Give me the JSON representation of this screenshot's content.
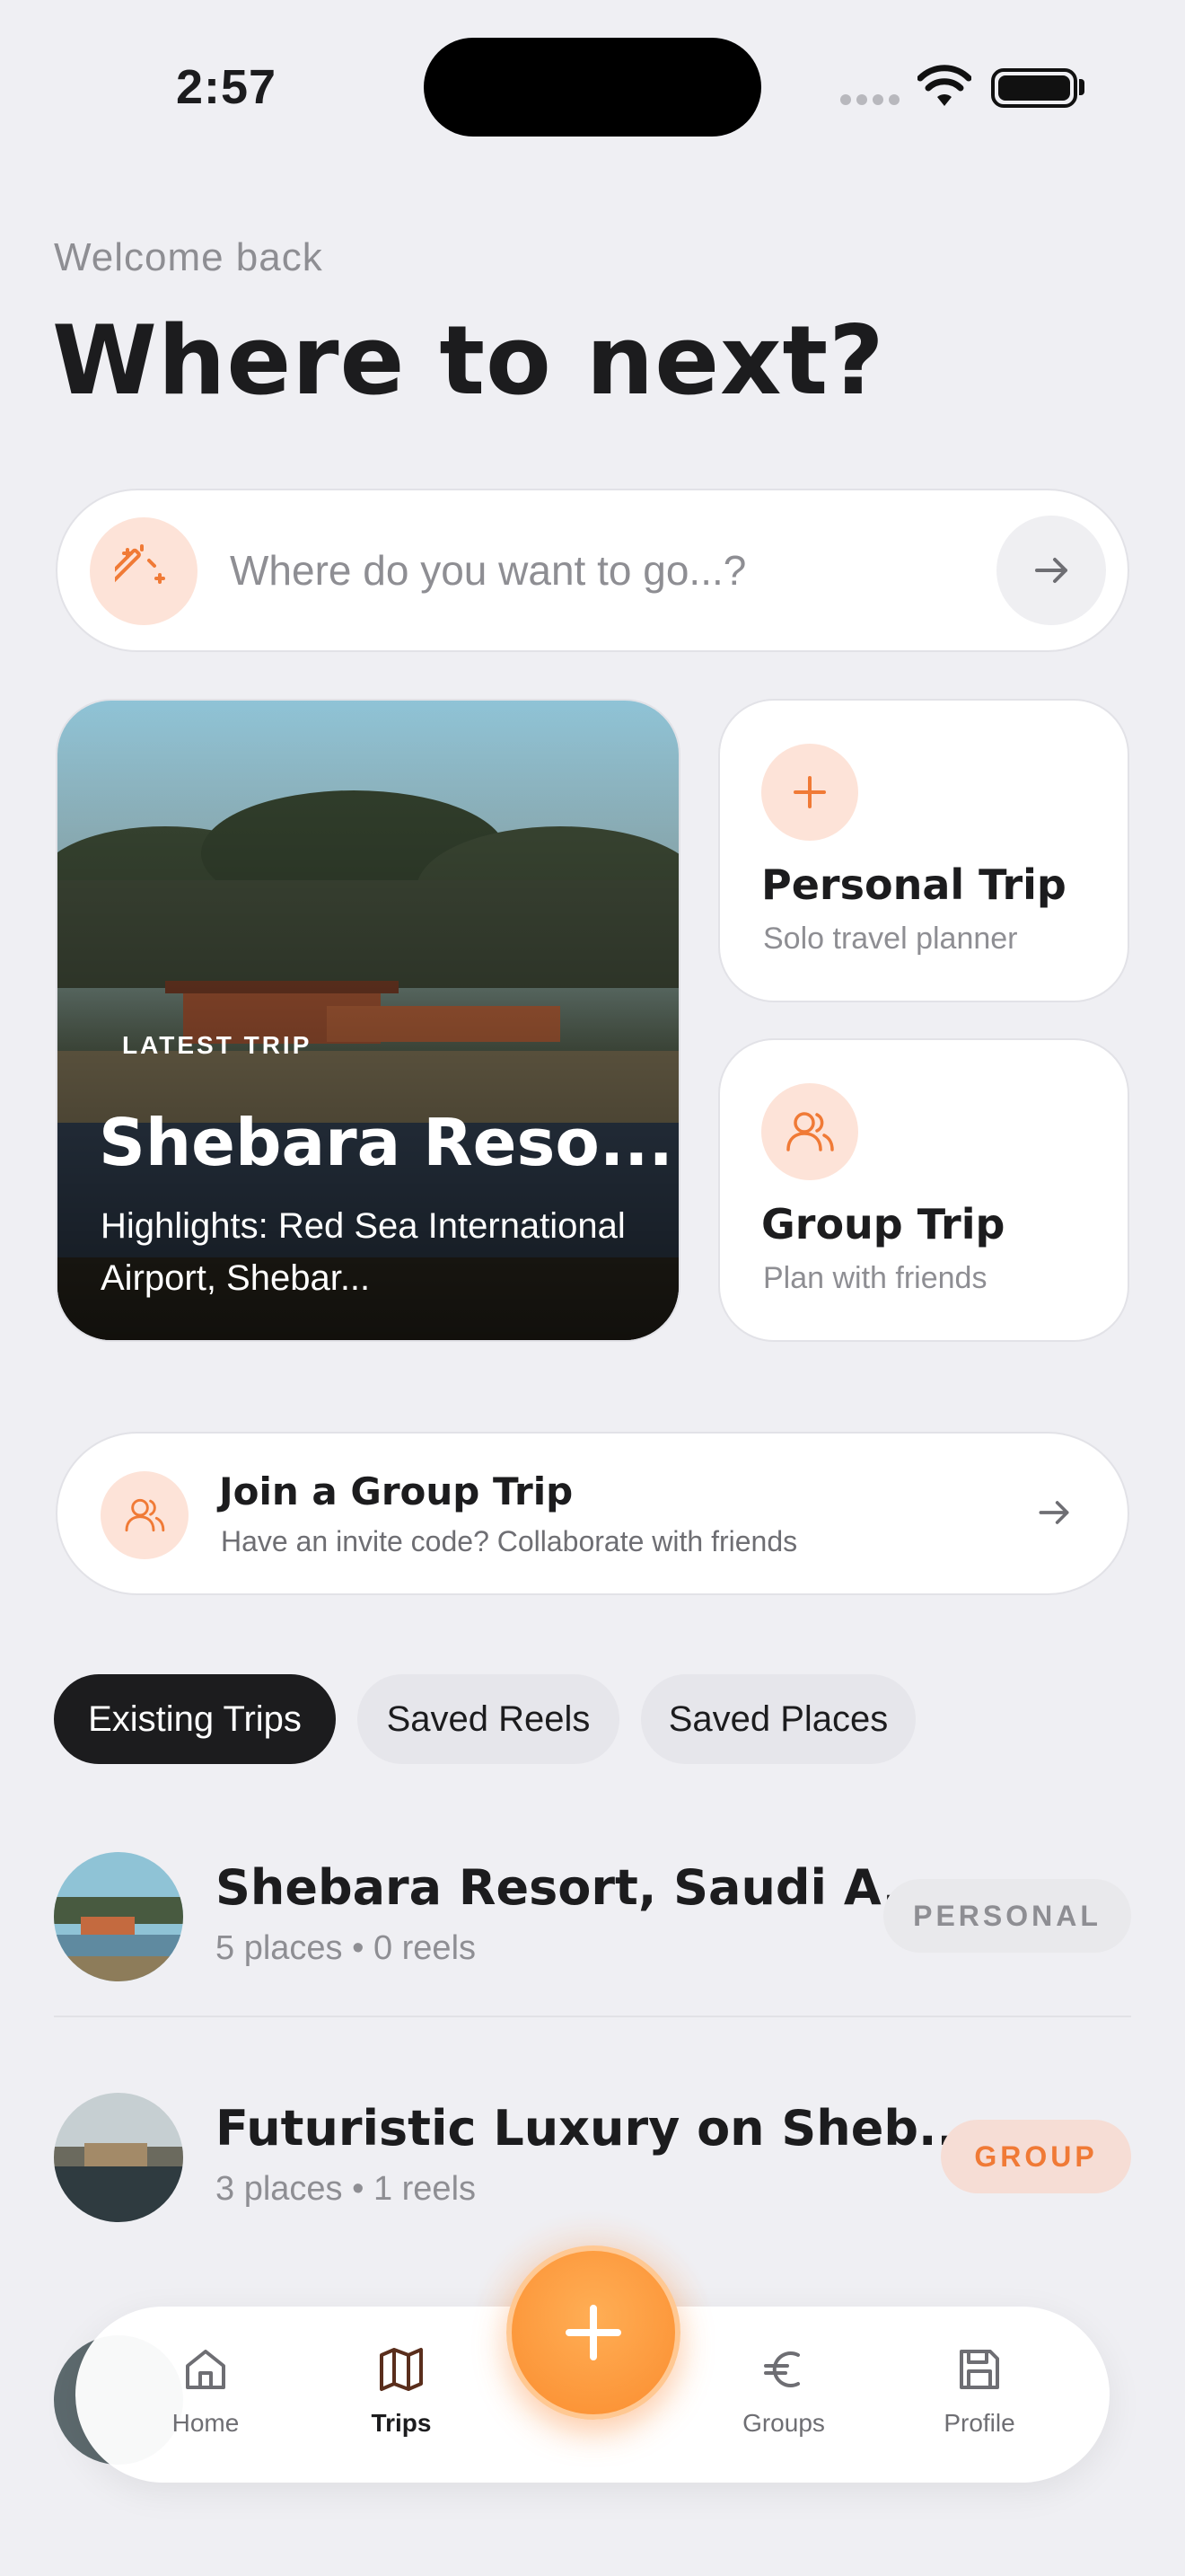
{
  "status_bar": {
    "time": "2:57"
  },
  "header": {
    "welcome": "Welcome back",
    "title": "Where to next?"
  },
  "search": {
    "placeholder": "Where do you want to go...?"
  },
  "latest_trip": {
    "badge": "LATEST TRIP",
    "name": "Shebara Reso...",
    "highlights": "Highlights: Red Sea International Airport, Shebar..."
  },
  "quick_actions": {
    "personal": {
      "title": "Personal Trip",
      "subtitle": "Solo travel planner"
    },
    "group": {
      "title": "Group Trip",
      "subtitle": "Plan with friends"
    }
  },
  "join": {
    "title": "Join a Group Trip",
    "subtitle": "Have an invite code? Collaborate with friends"
  },
  "tabs": [
    {
      "label": "Existing Trips",
      "active": true
    },
    {
      "label": "Saved Reels",
      "active": false
    },
    {
      "label": "Saved Places",
      "active": false
    }
  ],
  "trips": [
    {
      "name": "Shebara Resort, Saudi A...",
      "meta": "5 places • 0 reels",
      "tag": "PERSONAL"
    },
    {
      "name": "Futuristic Luxury on Sheb...",
      "meta": "3 places • 1 reels",
      "tag": "GROUP"
    }
  ],
  "nav": {
    "home": "Home",
    "trips": "Trips",
    "groups": "Groups",
    "profile": "Profile"
  },
  "colors": {
    "accent": "#f07a36",
    "accent_soft": "#fde3d8",
    "background": "#efeff3",
    "dark_pill": "#1c1c1e"
  },
  "icons": [
    "magic-wand-icon",
    "arrow-right-icon",
    "plus-icon",
    "users-icon",
    "home-icon",
    "map-icon",
    "euro-icon",
    "save-icon",
    "wifi-icon",
    "battery-icon"
  ]
}
